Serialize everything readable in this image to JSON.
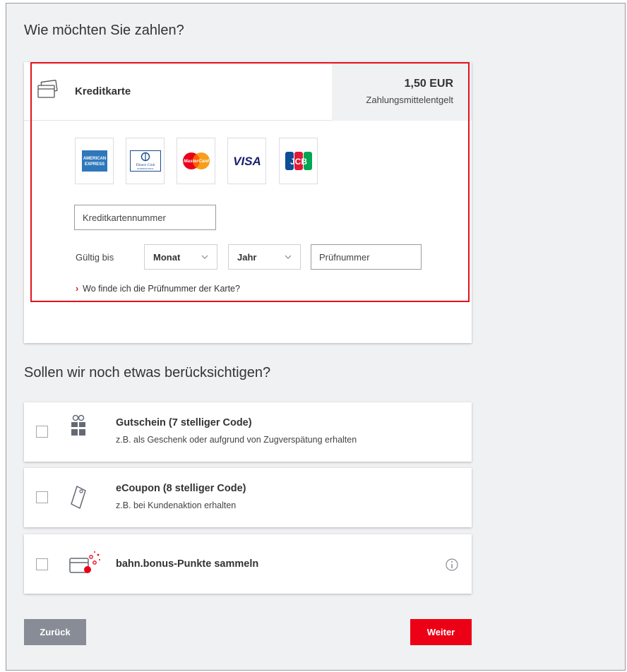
{
  "page": {
    "heading_payment": "Wie möchten Sie zahlen?",
    "heading_extras": "Sollen wir noch etwas berücksichtigen?"
  },
  "payment": {
    "method_label": "Kreditkarte",
    "method_icon": "credit-card-icon",
    "fee_amount": "1,50 EUR",
    "fee_label": "Zahlungsmittelentgelt",
    "card_logos": [
      {
        "name": "American Express",
        "icon": "amex-logo",
        "lines": [
          "AMERICAN",
          "EXPRESS"
        ]
      },
      {
        "name": "Diners Club",
        "icon": "diners-club-logo",
        "lines": [
          "Diners Club",
          "INTERNATIONAL"
        ]
      },
      {
        "name": "MasterCard",
        "icon": "mastercard-logo",
        "text": "MasterCard"
      },
      {
        "name": "VISA",
        "icon": "visa-logo",
        "text": "VISA"
      },
      {
        "name": "JCB",
        "icon": "jcb-logo",
        "text": "JCB"
      }
    ],
    "card_number_placeholder": "Kreditkartennummer",
    "valid_until_label": "Gültig bis",
    "month_select": "Monat",
    "year_select": "Jahr",
    "cvc_placeholder": "Prüfnummer",
    "help_link": "Wo finde ich die Prüfnummer der Karte?",
    "highlight_color": "#e3121e"
  },
  "extras": [
    {
      "title": "Gutschein (7 stelliger Code)",
      "subtitle": "z.B. als Geschenk oder aufgrund von Zugverspätung erhalten",
      "icon": "gift-icon",
      "checked": false
    },
    {
      "title": "eCoupon (8 stelliger Code)",
      "subtitle": "z.B. bei Kundenaktion erhalten",
      "icon": "ticket-icon",
      "checked": false
    },
    {
      "title": "bahn.bonus-Punkte sammeln",
      "subtitle": "",
      "icon": "bonus-card-icon",
      "info_icon": "info-icon",
      "checked": false
    }
  ],
  "buttons": {
    "back": "Zurück",
    "next": "Weiter",
    "next_color": "#ec0016",
    "back_color": "#878c96"
  }
}
